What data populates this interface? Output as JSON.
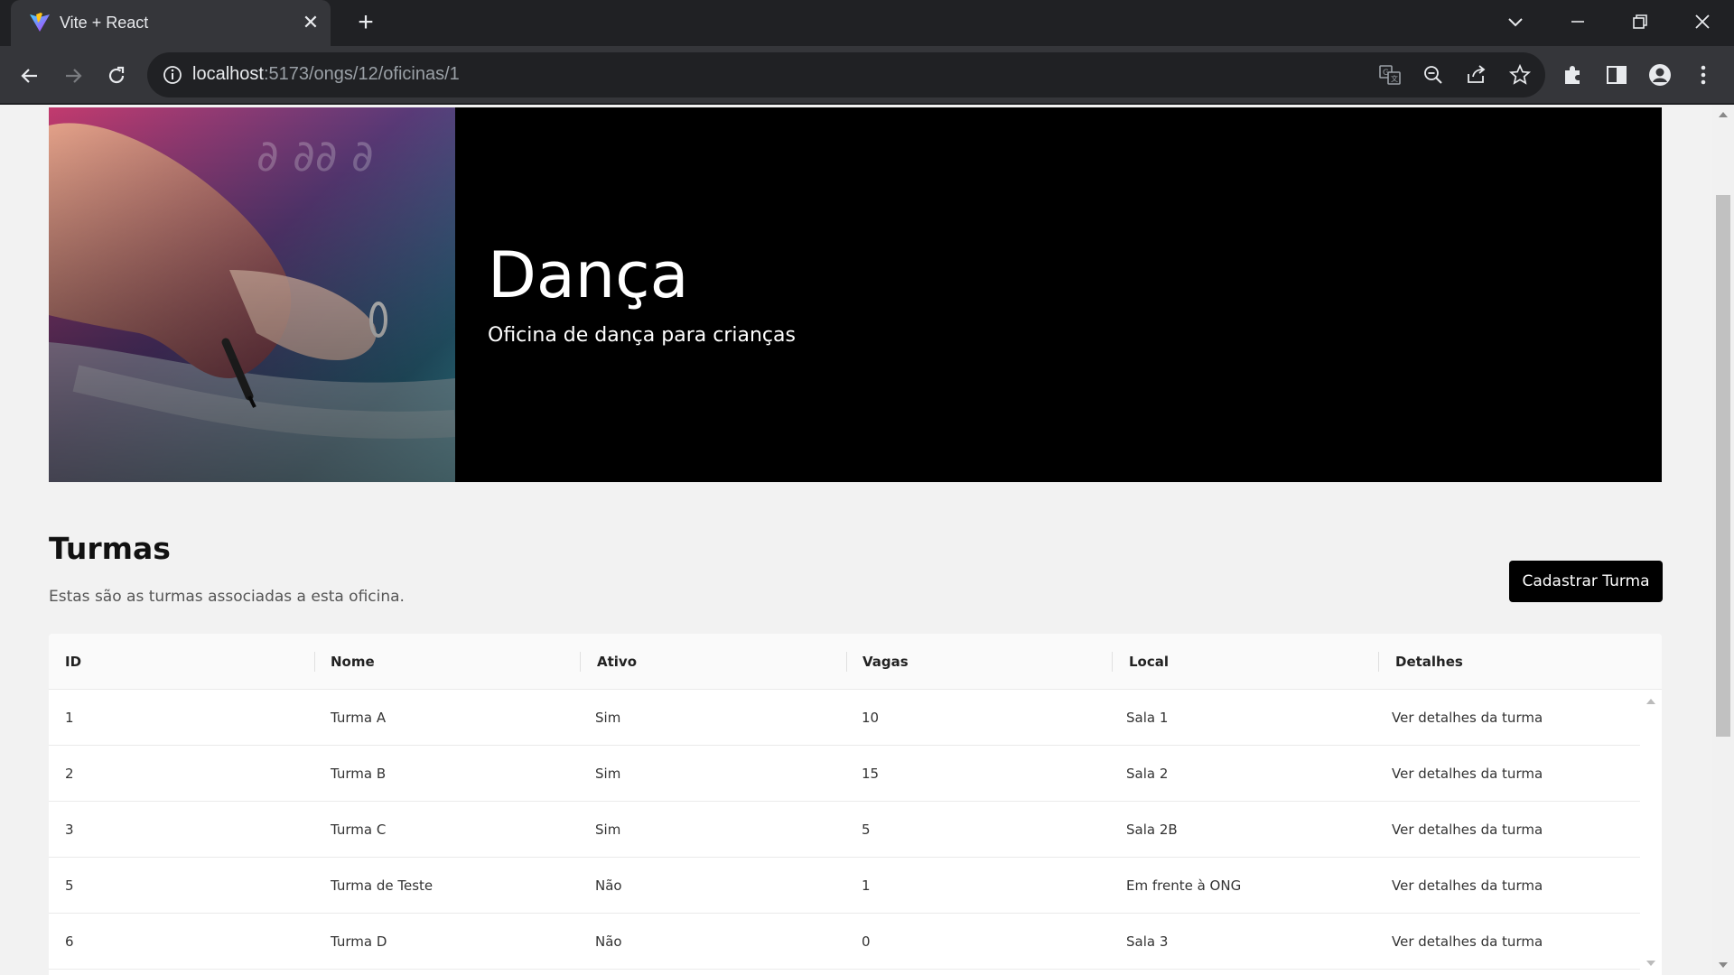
{
  "browser": {
    "tab_title": "Vite + React",
    "url_host": "localhost",
    "url_path": ":5173/ongs/12/oficinas/1"
  },
  "hero": {
    "title": "Dança",
    "subtitle": "Oficina de dança para crianças"
  },
  "section": {
    "title": "Turmas",
    "description": "Estas são as turmas associadas a esta oficina.",
    "add_button": "Cadastrar Turma"
  },
  "table": {
    "columns": [
      "ID",
      "Nome",
      "Ativo",
      "Vagas",
      "Local",
      "Detalhes"
    ],
    "rows": [
      [
        "1",
        "Turma A",
        "Sim",
        "10",
        "Sala 1",
        "Ver detalhes da turma"
      ],
      [
        "2",
        "Turma B",
        "Sim",
        "15",
        "Sala 2",
        "Ver detalhes da turma"
      ],
      [
        "3",
        "Turma C",
        "Sim",
        "5",
        "Sala 2B",
        "Ver detalhes da turma"
      ],
      [
        "5",
        "Turma de Teste",
        "Não",
        "1",
        "Em frente à ONG",
        "Ver detalhes da turma"
      ],
      [
        "6",
        "Turma D",
        "Não",
        "0",
        "Sala 3",
        "Ver detalhes da turma"
      ]
    ]
  },
  "colors": {
    "chrome_dark": "#202124",
    "chrome_toolbar": "#35363a",
    "hero_bg": "#000000",
    "button_bg": "#000000",
    "page_bg": "#f2f2f2"
  }
}
